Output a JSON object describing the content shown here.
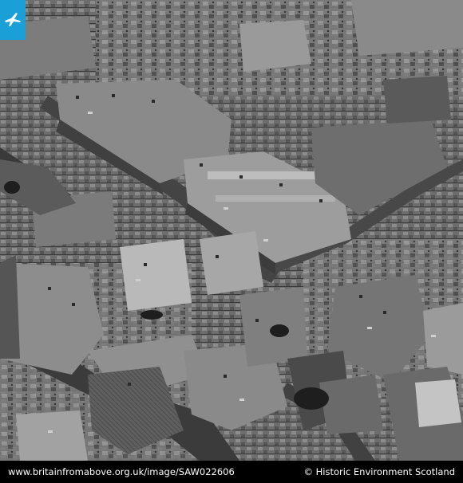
{
  "footer": {
    "url": "www.britainfromabove.org.uk/image/SAW022606",
    "credit": "© Historic Environment Scotland"
  },
  "badge": {
    "icon": "airplane-icon",
    "color": "#1a9fd6"
  },
  "photo": {
    "subject": "aerial-photograph",
    "tone": "black-and-white"
  }
}
